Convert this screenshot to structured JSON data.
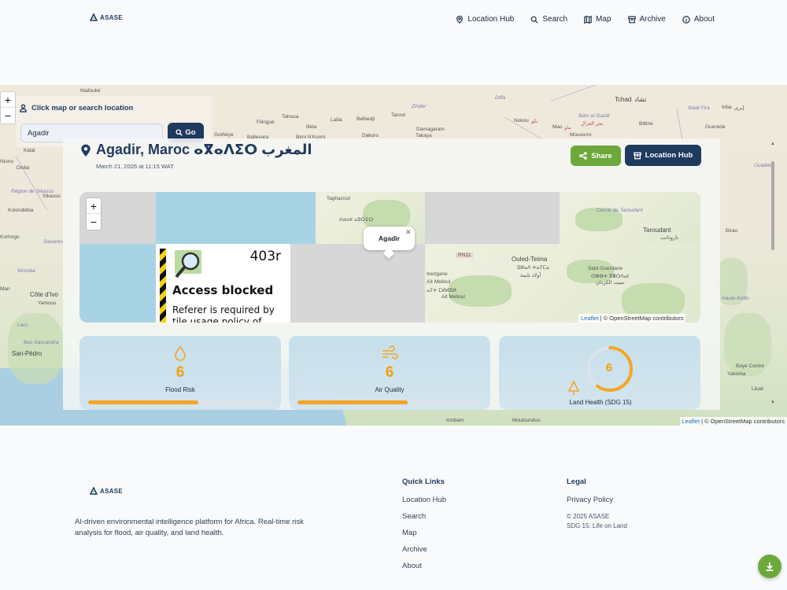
{
  "brand": {
    "name": "ASASE"
  },
  "nav": [
    {
      "label": "Location Hub",
      "icon": "map-pin-icon"
    },
    {
      "label": "Search",
      "icon": "search-icon"
    },
    {
      "label": "Map",
      "icon": "map-icon"
    },
    {
      "label": "Archive",
      "icon": "archive-icon"
    },
    {
      "label": "About",
      "icon": "info-icon"
    }
  ],
  "map": {
    "search_title": "Click map or search location",
    "search_value": "Agadir",
    "go_label": "Go",
    "attribution_leaflet": "Leaflet",
    "attribution_rest": " | © OpenStreetMap contributors",
    "labels": [
      "Niafouké",
      "Tahoua",
      "Laba",
      "Belbedji",
      "Tarout",
      "Zinder",
      "Diffa",
      "Tchad",
      "تشاد",
      "Wadi Fira",
      "Iriba",
      "إيرى",
      "Kidal",
      "Filingué",
      "Illela",
      "Nokou",
      "نكو",
      "Mao",
      "ماو",
      "Bahr el Gazél",
      "بحر الغزال",
      "Biltine",
      "Guereda",
      "Gothèye",
      "Dakoro",
      "Damagaram",
      "Takaya",
      "Mousorro",
      "Balleyara",
      "Birni N'Konni",
      "Niono",
      "Diolla",
      "Sikasso",
      "Kolondiéba",
      "Région de Sikasso",
      "Korhogo",
      "Savanes",
      "Woroba",
      "Côte d'Ivo",
      "Yamous",
      "Lacs",
      "Bas-Sassandra",
      "San-Pédro",
      "Man",
      "Ambam",
      "Mouloundou",
      "Baye Centre",
      "Yakoma",
      "Likati",
      "Birao",
      "Haute-Kotto",
      "Ouaddaï"
    ]
  },
  "location": {
    "title": "Agadir, Maroc ⴰⴳⴰⴷⵉⵔ المغرب",
    "date": "March 21, 2026 at 11:15 WAT",
    "share_label": "Share",
    "hub_label": "Location Hub"
  },
  "inner_map": {
    "popup": "Agadir",
    "blocked_code": "403r",
    "blocked_heading": "Access blocked",
    "blocked_msg": "Referer is required by tile usage policy of",
    "labels": [
      "Taghazout",
      "Aourir ⴰⵓⵔⵉⵔ",
      "RN11",
      "Ouled-Teima",
      "ⵓⵍⴰⴷ ⵜⴰⵢⵎⴰ",
      "أولاد تايمة",
      "Sebt Guerdane",
      "ⵙⴻⴱⵜ ⴳⴻⵔⴷⴰⵏ",
      "سبت الكردان",
      "Taroudant",
      "تارودانت",
      "Cercle de Taroudant",
      "Inezgane",
      "Aït Melloul",
      "ⴰⵢⵜ ⵎⵍⵍⵓⵍ",
      "Ait Melloul"
    ],
    "attribution_leaflet": "Leaflet",
    "attribution_rest": " | © OpenStreetMap contributors"
  },
  "metrics": [
    {
      "value": "6",
      "label": "Flood Risk",
      "level": 0.6
    },
    {
      "value": "6",
      "label": "Air Quality",
      "level": 0.6
    },
    {
      "value": "6",
      "label": "Land Health (SDG 15)",
      "level": 0.6
    }
  ],
  "footer": {
    "description": "AI-driven environmental intelligence platform for Africa. Real-time risk analysis for flood, air quality, and land health.",
    "quick_links_title": "Quick Links",
    "quick_links": [
      "Location Hub",
      "Search",
      "Map",
      "Archive",
      "About"
    ],
    "legal_title": "Legal",
    "privacy": "Privacy Policy",
    "copyright": "© 2025 ASASE",
    "sdg": "SDG 15: Life on Land"
  },
  "colors": {
    "primary": "#1e3a5f",
    "accent_green": "#6ca83a",
    "metric_orange": "#f59e0b"
  }
}
